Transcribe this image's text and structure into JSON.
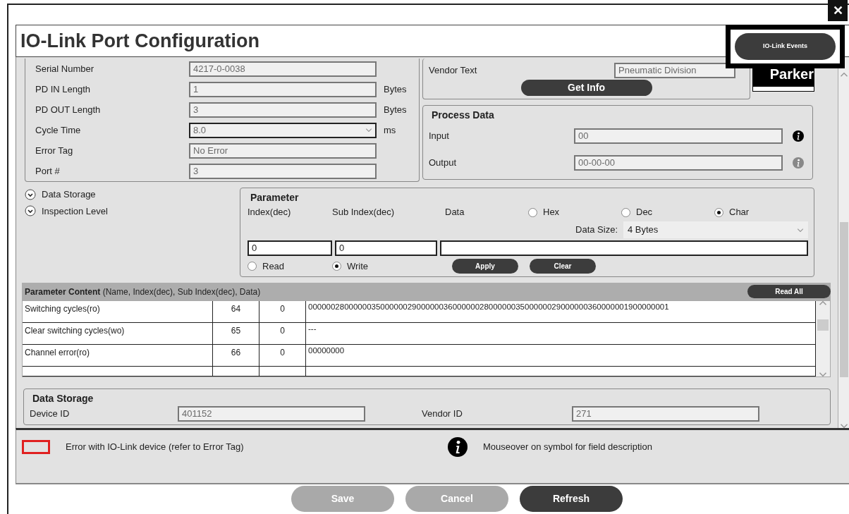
{
  "window": {
    "title": "IO-Link Port Configuration",
    "close": "✕"
  },
  "events_button": "IO-Link Events",
  "device_fields": [
    {
      "label": "Serial Number",
      "value": "4217-0-0038",
      "kind": "text"
    },
    {
      "label": "PD IN Length",
      "value": "1",
      "unit": "Bytes",
      "kind": "text"
    },
    {
      "label": "PD OUT Length",
      "value": "3",
      "unit": "Bytes",
      "kind": "text"
    },
    {
      "label": "Cycle Time",
      "value": "8.0",
      "unit": "ms",
      "kind": "select"
    },
    {
      "label": "Error Tag",
      "value": "No Error",
      "kind": "text"
    },
    {
      "label": "Port #",
      "value": "3",
      "kind": "text"
    }
  ],
  "vendor": {
    "label": "Vendor Text",
    "value": "Pneumatic Division",
    "button": "Get Info"
  },
  "logo": "Parker",
  "process_data": {
    "title": "Process Data",
    "rows": [
      {
        "label": "Input",
        "value": "00",
        "disabled": false
      },
      {
        "label": "Output",
        "value": "00-00-00",
        "disabled": true
      }
    ]
  },
  "sections": [
    {
      "label": "Data Storage",
      "expanded": false
    },
    {
      "label": "Inspection Level",
      "expanded": false
    }
  ],
  "parameter": {
    "title": "Parameter",
    "columns": [
      "Index(dec)",
      "Sub Index(dec)",
      "Data"
    ],
    "formats": [
      {
        "label": "Hex",
        "selected": false
      },
      {
        "label": "Dec",
        "selected": false
      },
      {
        "label": "Char",
        "selected": true
      }
    ],
    "data_size_label": "Data Size:",
    "data_size": "4 Bytes",
    "index": "0",
    "sub_index": "0",
    "modes": [
      {
        "label": "Read",
        "selected": false
      },
      {
        "label": "Write",
        "selected": true
      }
    ],
    "buttons": [
      "Apply",
      "Clear"
    ]
  },
  "parameter_content": {
    "title": "Parameter Content",
    "subtitle": "(Name, Index(dec), Sub Index(dec), Data)",
    "button": "Read All",
    "rows": [
      {
        "name": "Switching cycles(ro)",
        "index": "64",
        "sub_index": "0",
        "data": "00000028000000350000002900000036000000280000003500000029000000360000001900000001"
      },
      {
        "name": "Clear switching cycles(wo)",
        "index": "65",
        "sub_index": "0",
        "data": "---"
      },
      {
        "name": "Channel error(ro)",
        "index": "66",
        "sub_index": "0",
        "data": "00000000"
      }
    ]
  },
  "data_storage": {
    "title": "Data Storage",
    "fields": [
      {
        "label": "Device ID",
        "value": "401152"
      },
      {
        "label": "Vendor ID",
        "value": "271"
      }
    ]
  },
  "legend": [
    {
      "kind": "error",
      "text": "Error with IO-Link device (refer to Error Tag)"
    },
    {
      "kind": "info",
      "text": "Mouseover on symbol for field description"
    }
  ],
  "buttons": [
    {
      "label": "Save",
      "disabled": true
    },
    {
      "label": "Cancel",
      "disabled": true
    },
    {
      "label": "Refresh",
      "disabled": false
    }
  ]
}
